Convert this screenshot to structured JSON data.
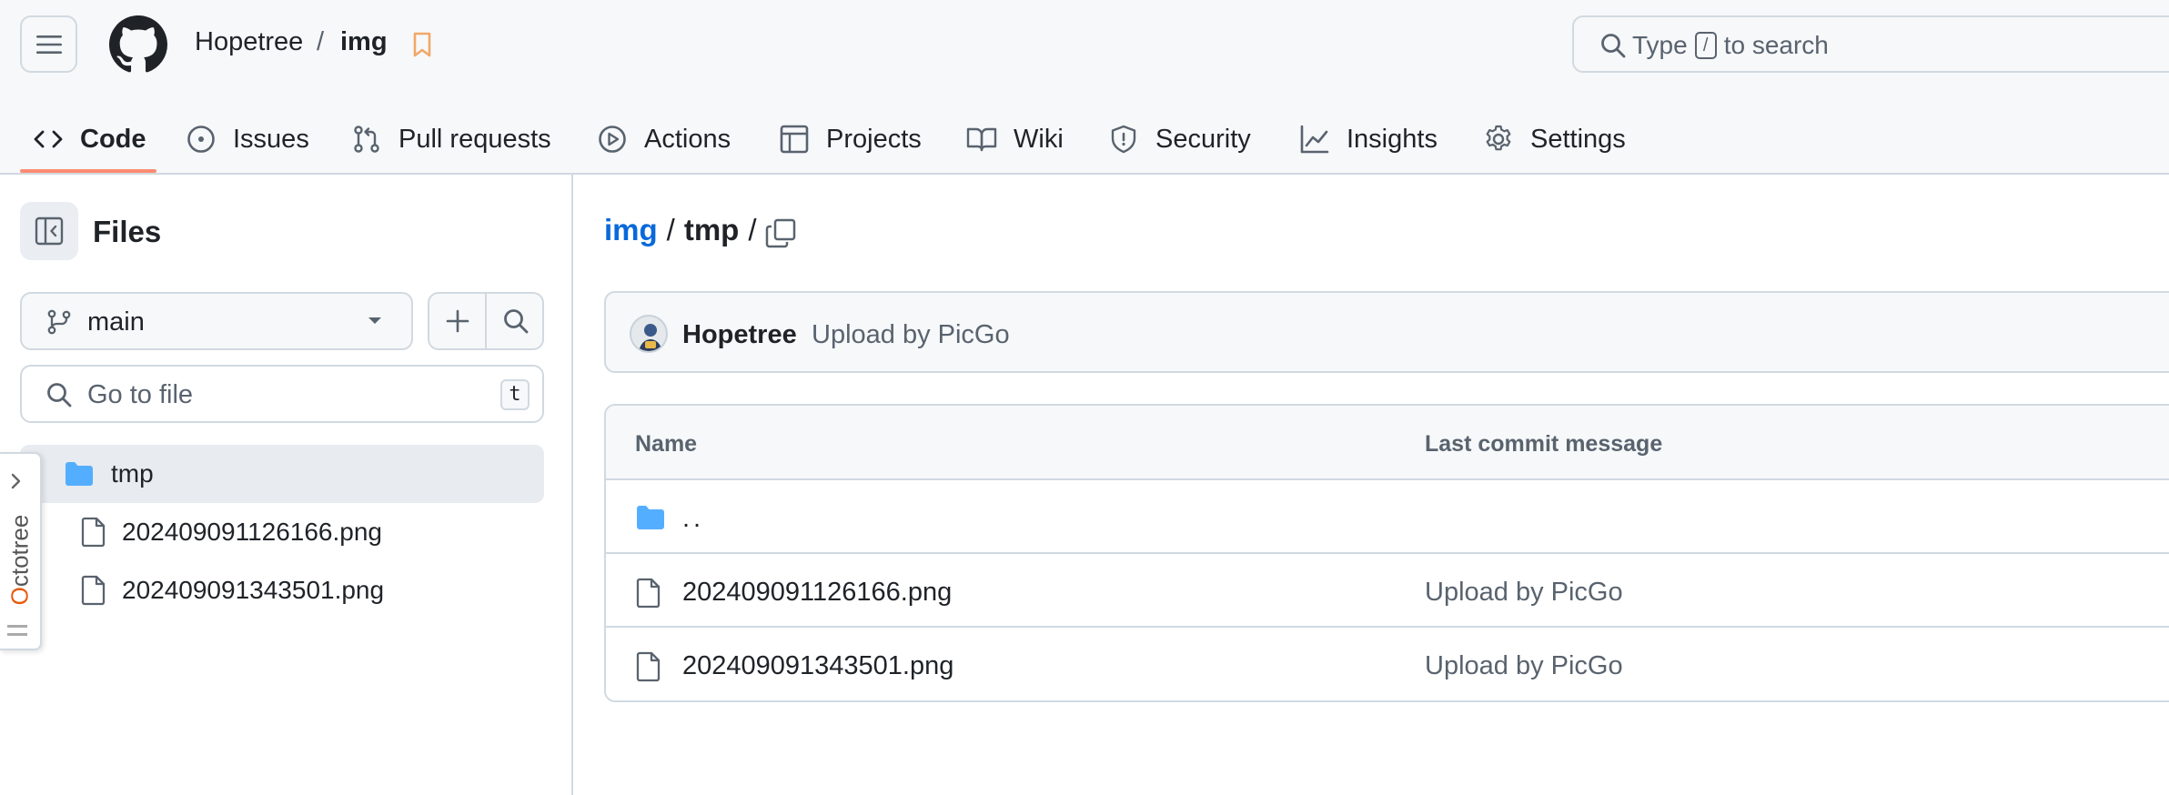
{
  "header": {
    "owner": "Hopetree",
    "separator": "/",
    "repo": "img",
    "search": {
      "prefix": "Type",
      "key": "/",
      "suffix": "to search"
    }
  },
  "nav": {
    "tabs": [
      {
        "label": "Code",
        "icon": "code-icon",
        "active": true
      },
      {
        "label": "Issues",
        "icon": "issue-icon"
      },
      {
        "label": "Pull requests",
        "icon": "pull-request-icon"
      },
      {
        "label": "Actions",
        "icon": "play-icon"
      },
      {
        "label": "Projects",
        "icon": "table-icon"
      },
      {
        "label": "Wiki",
        "icon": "book-icon"
      },
      {
        "label": "Security",
        "icon": "shield-icon"
      },
      {
        "label": "Insights",
        "icon": "graph-icon"
      },
      {
        "label": "Settings",
        "icon": "gear-icon"
      }
    ]
  },
  "sidebar": {
    "title": "Files",
    "branch": "main",
    "goto_placeholder": "Go to file",
    "goto_key": "t",
    "tree": [
      {
        "label": "tmp",
        "type": "folder",
        "selected": true
      },
      {
        "label": "202409091126166.png",
        "type": "file"
      },
      {
        "label": "202409091343501.png",
        "type": "file"
      }
    ]
  },
  "octotree": {
    "first_letter": "O",
    "rest": "ctotree"
  },
  "main": {
    "breadcrumb": {
      "root": "img",
      "sep": "/",
      "current": "tmp",
      "trailing_sep": "/"
    },
    "latest_commit": {
      "author": "Hopetree",
      "message": "Upload by PicGo"
    },
    "table": {
      "columns": {
        "name": "Name",
        "last_commit": "Last commit message"
      },
      "rows": [
        {
          "name": "..",
          "type": "parent",
          "message": ""
        },
        {
          "name": "202409091126166.png",
          "type": "file",
          "message": "Upload by PicGo"
        },
        {
          "name": "202409091343501.png",
          "type": "file",
          "message": "Upload by PicGo"
        }
      ]
    }
  },
  "colors": {
    "accent_underline": "#fd8c73",
    "link": "#0969da",
    "folder": "#54aeff",
    "bookmark": "#f0a868",
    "octotree_accent": "#e8590c"
  }
}
